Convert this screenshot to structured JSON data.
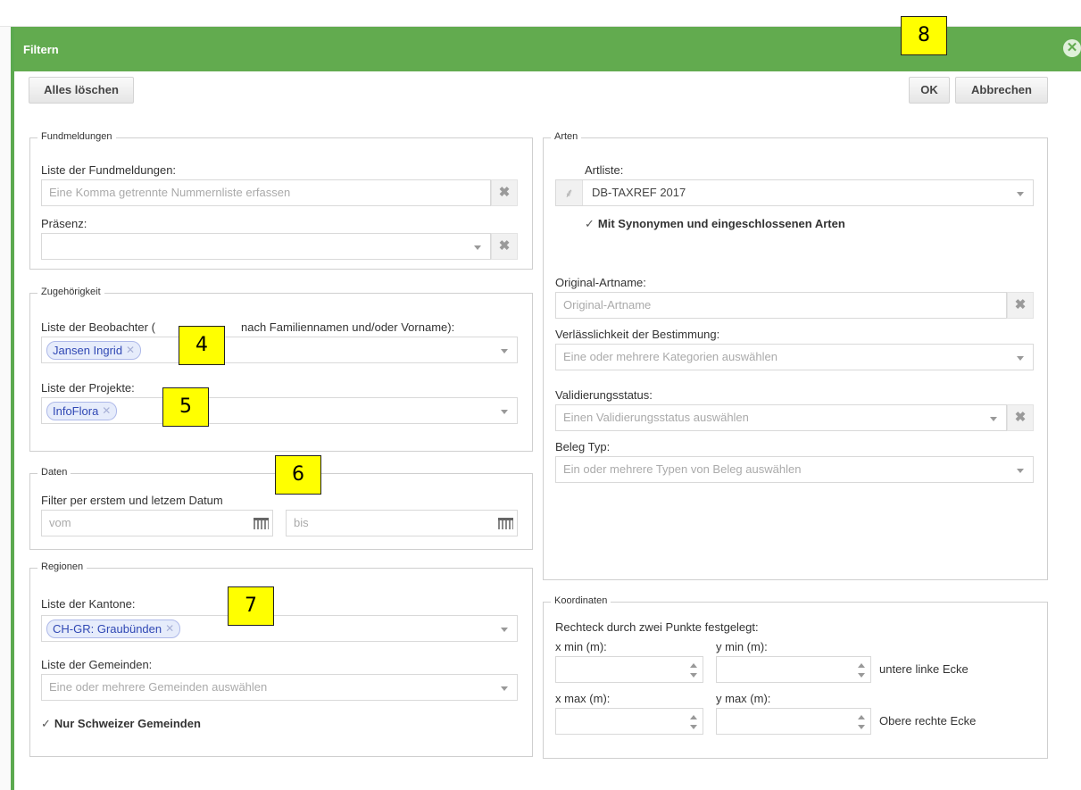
{
  "dialog": {
    "title": "Filtern",
    "clear_all": "Alles löschen",
    "ok": "OK",
    "cancel": "Abbrechen"
  },
  "fundmeldungen": {
    "legend": "Fundmeldungen",
    "list_label": "Liste der Fundmeldungen:",
    "list_placeholder": "Eine Komma getrennte Nummernliste erfassen",
    "presence_label": "Präsenz:"
  },
  "zugehoerigkeit": {
    "legend": "Zugehörigkeit",
    "observers_label_a": "Liste der Beobachter (",
    "observers_label_b": "nach Familiennamen und/oder Vorname):",
    "observer_chip": "Jansen Ingrid",
    "projects_label": "Liste der Projekte:",
    "project_chip": "InfoFlora"
  },
  "daten": {
    "legend": "Daten",
    "filter_label": "Filter per erstem und letzem Datum",
    "from_placeholder": "vom",
    "to_placeholder": "bis"
  },
  "regionen": {
    "legend": "Regionen",
    "cantons_label": "Liste der Kantone:",
    "canton_chip": "CH-GR: Graubünden",
    "communes_label": "Liste der Gemeinden:",
    "communes_placeholder": "Eine oder mehrere Gemeinden auswählen",
    "swiss_only": "Nur Schweizer Gemeinden"
  },
  "arten": {
    "legend": "Arten",
    "list_label": "Artliste:",
    "list_value": "DB-TAXREF 2017",
    "synonyms": "Mit Synonymen und eingeschlossenen Arten",
    "original_label": "Original-Artname:",
    "original_placeholder": "Original-Artname",
    "reliability_label": "Verlässlichkeit der Bestimmung:",
    "reliability_placeholder": "Eine oder mehrere Kategorien auswählen",
    "validation_label": "Validierungsstatus:",
    "validation_placeholder": "Einen Validierungsstatus auswählen",
    "voucher_label": "Beleg Typ:",
    "voucher_placeholder": "Ein oder mehrere Typen von Beleg auswählen"
  },
  "koordinaten": {
    "legend": "Koordinaten",
    "desc": "Rechteck durch zwei Punkte festgelegt:",
    "xmin": "x min (m):",
    "ymin": "y min (m):",
    "xmax": "x max (m):",
    "ymax": "y max (m):",
    "lower_left": "untere linke Ecke",
    "upper_right": "Obere rechte Ecke"
  },
  "annotations": [
    "4",
    "5",
    "6",
    "7",
    "8"
  ],
  "colors": {
    "title_bar": "#62ab4f",
    "chip_bg": "#e6ecfb",
    "annotation": "#ffff00"
  }
}
